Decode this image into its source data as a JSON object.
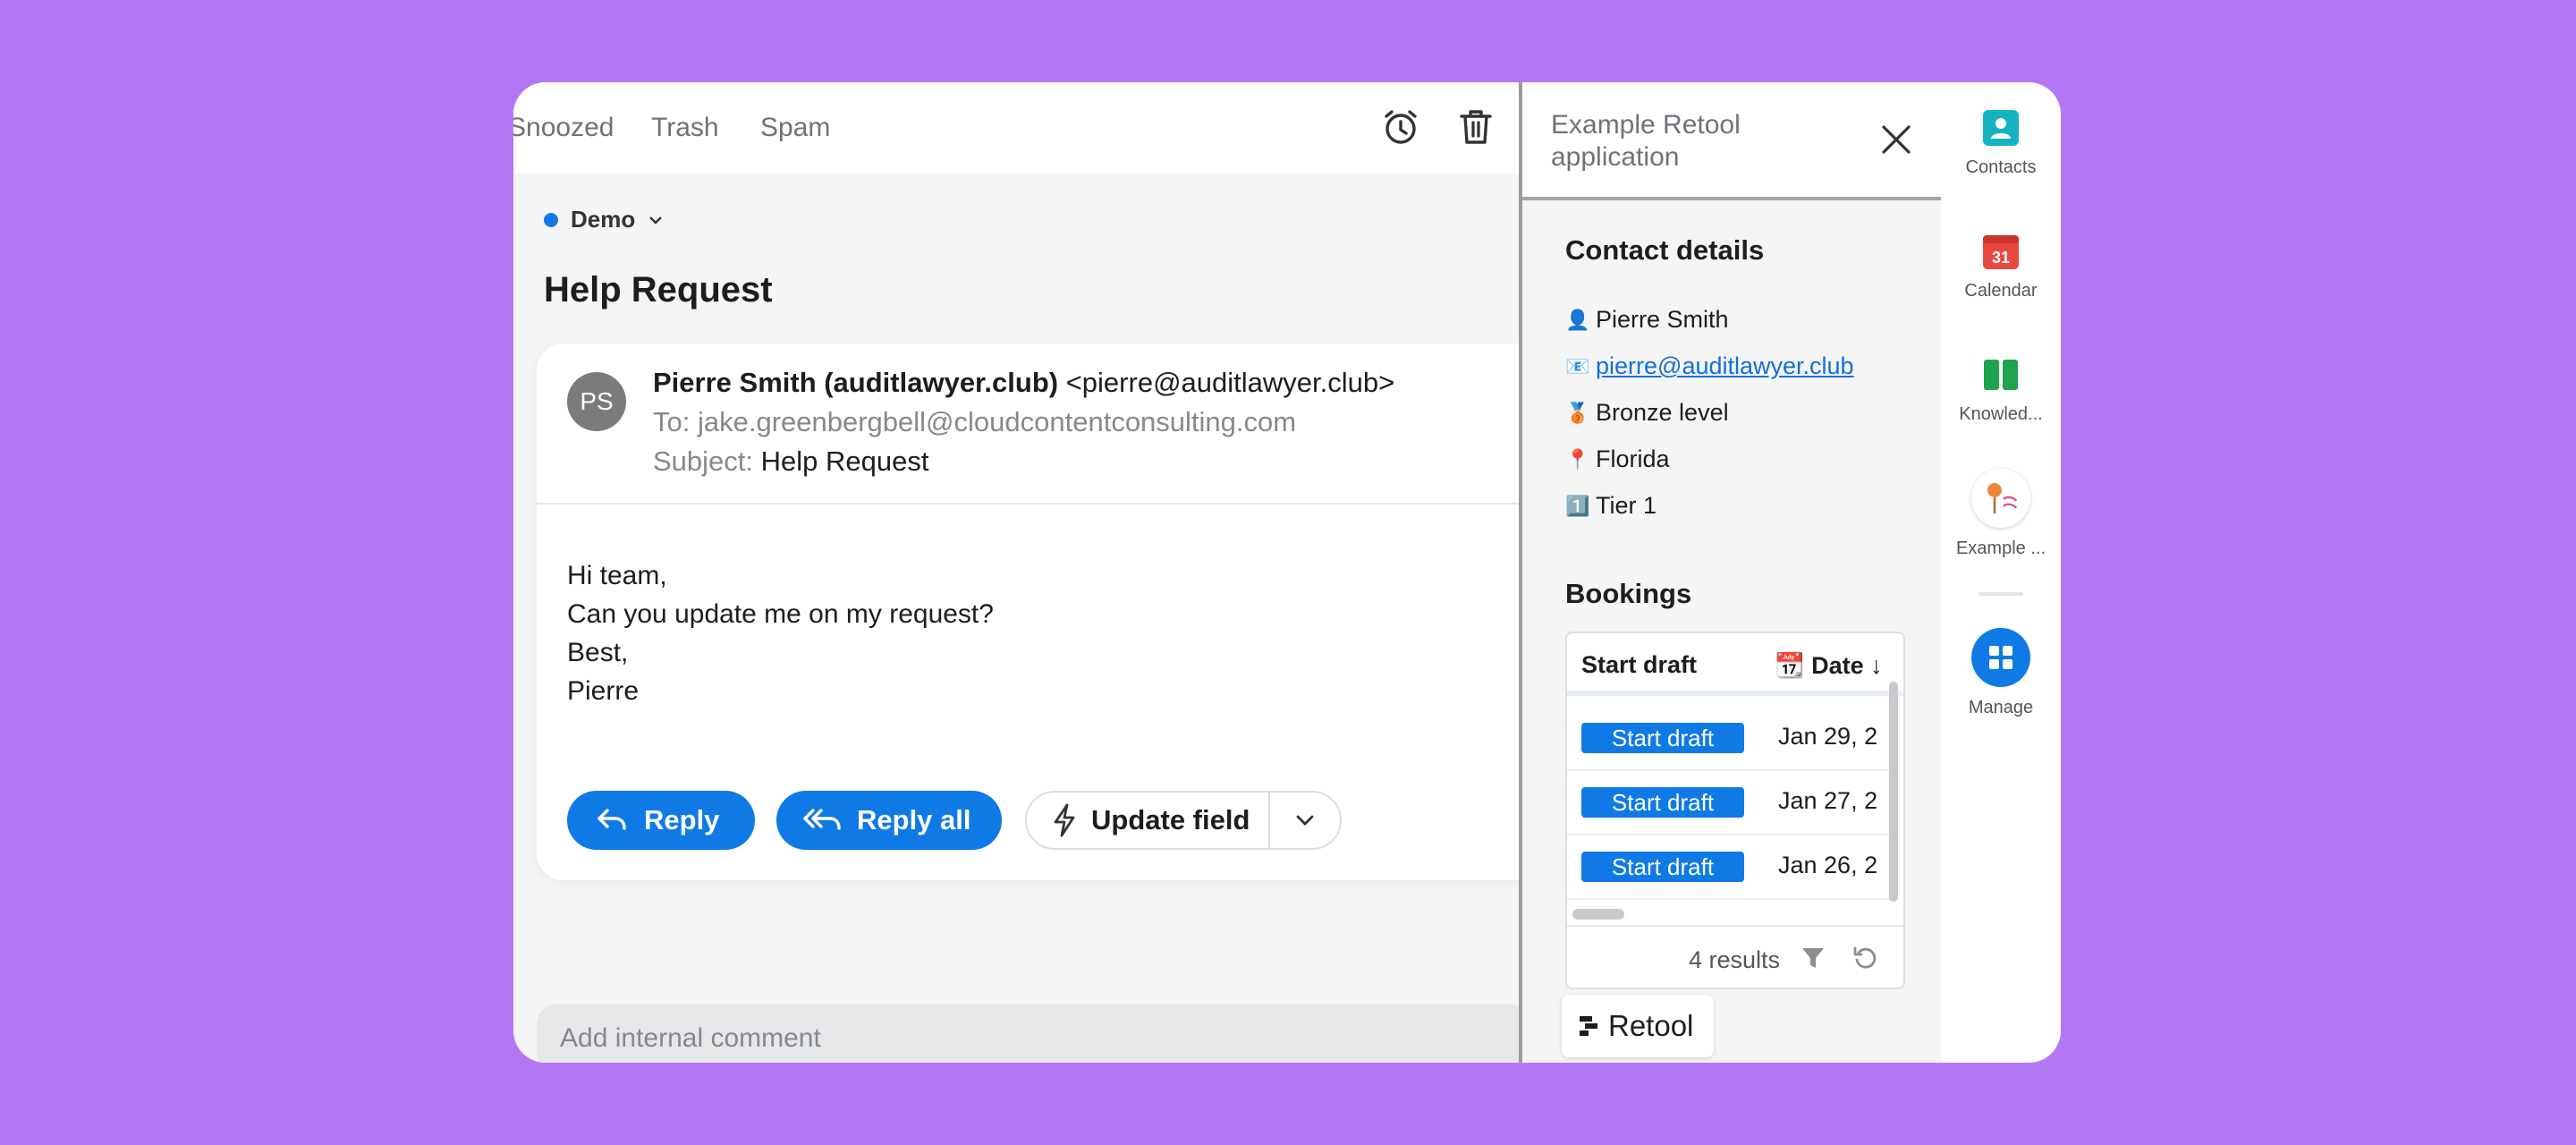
{
  "email": {
    "folders": [
      "Snoozed",
      "Trash",
      "Spam"
    ],
    "label": "Demo",
    "subject_title": "Help Request",
    "sender_initials": "PS",
    "from_name": "Pierre Smith (auditlawyer.club)",
    "from_address": "<pierre@auditlawyer.club>",
    "to_label": "To:",
    "to_value": "jake.greenbergbell@cloudcontentconsulting.com",
    "subject_label": "Subject:",
    "subject_value": "Help Request",
    "body_lines": [
      "Hi team,",
      "Can you update me on my request?",
      "Best,",
      "Pierre"
    ],
    "reply_label": "Reply",
    "reply_all_label": "Reply all",
    "update_field_label": "Update field",
    "comment_placeholder": "Add internal comment"
  },
  "retool": {
    "title": "Example Retool application",
    "contact_heading": "Contact details",
    "contact": {
      "name": "Pierre Smith",
      "email": "pierre@auditlawyer.club",
      "level": "Bronze level",
      "location": "Florida",
      "tier": "Tier 1"
    },
    "bookings_heading": "Bookings",
    "table": {
      "columns": [
        "Start draft",
        "📆 Date ↓"
      ],
      "rows": [
        {
          "action": "Start draft",
          "date": "Jan 29, 2"
        },
        {
          "action": "Start draft",
          "date": "Jan 27, 2"
        },
        {
          "action": "Start draft",
          "date": "Jan 26, 2"
        }
      ],
      "results": "4 results"
    },
    "brand": "Retool"
  },
  "apps": {
    "contacts": "Contacts",
    "calendar": "Calendar",
    "calendar_day": "31",
    "knowledge": "Knowled...",
    "example": "Example ...",
    "manage": "Manage"
  },
  "colors": {
    "background": "#b477f3",
    "primary": "#0f7ae5",
    "contacts_teal": "#15b3c1",
    "calendar_red": "#e8473f",
    "knowledge_green": "#1fa34f"
  }
}
